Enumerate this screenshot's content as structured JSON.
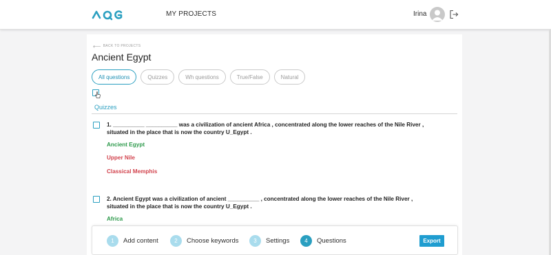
{
  "header": {
    "logo_text": "AQG",
    "nav_link": "MY PROJECTS",
    "user_name": "Irina"
  },
  "page": {
    "back_label": "BACK TO PROJECTS",
    "title": "Ancient Egypt"
  },
  "filters": [
    {
      "label": "All questions",
      "active": true
    },
    {
      "label": "Quizzes",
      "active": false
    },
    {
      "label": "Wh questions",
      "active": false
    },
    {
      "label": "True/False",
      "active": false
    },
    {
      "label": "Natural",
      "active": false
    }
  ],
  "section_label": "Quizzes",
  "questions": [
    {
      "line1": "1. __________ __________ was a civilization of ancient Africa , concentrated along the lower reaches of the Nile River ,",
      "line2": "situated in the place that is now the country U_Egypt .",
      "answers": [
        {
          "text": "Ancient Egypt",
          "correct": true
        },
        {
          "text": "Upper Nile",
          "correct": false
        },
        {
          "text": "Classical Memphis",
          "correct": false
        }
      ]
    },
    {
      "line1": "2. Ancient Egypt was a civilization of ancient __________ , concentrated along the lower reaches of the Nile River ,",
      "line2": "situated in the place that is now the country U_Egypt .",
      "answers": [
        {
          "text": "Africa",
          "correct": true
        }
      ]
    }
  ],
  "steps": [
    {
      "num": "1",
      "label": "Add content"
    },
    {
      "num": "2",
      "label": "Choose keywords"
    },
    {
      "num": "3",
      "label": "Settings"
    },
    {
      "num": "4",
      "label": "Questions"
    }
  ],
  "export_label": "Export",
  "colors": {
    "accent": "#2a9fc0",
    "correct": "#2e9a4c",
    "wrong": "#d2444e",
    "export": "#1f9dd0"
  }
}
